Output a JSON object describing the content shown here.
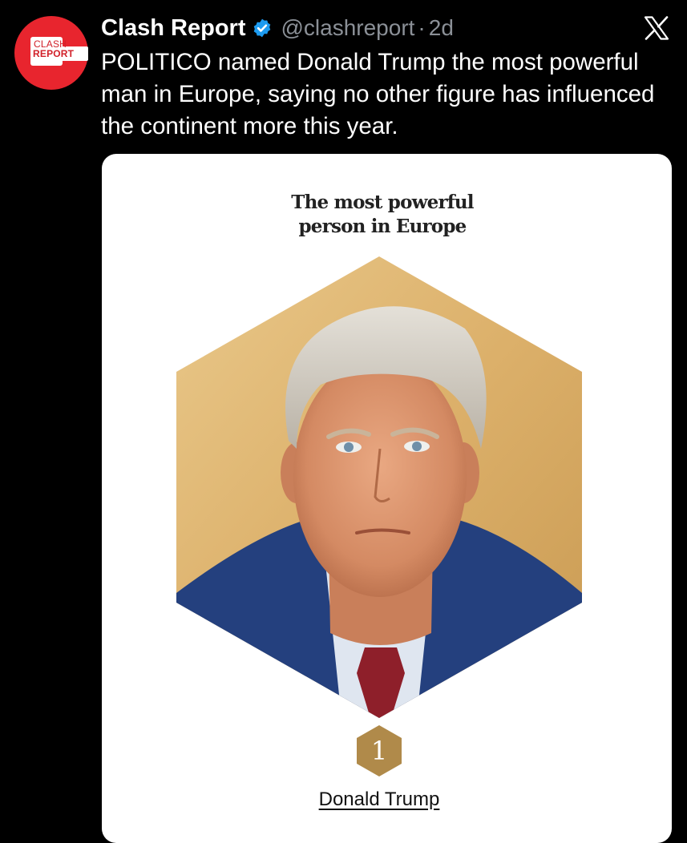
{
  "tweet": {
    "author_name": "Clash Report",
    "author_handle": "@clashreport",
    "separator": "·",
    "time_ago": "2d",
    "avatar_line1": "CLASH",
    "avatar_line2": "REPORT",
    "text": "POLITICO named Donald Trump the most powerful man in Europe, saying no other figure has influenced the continent more this year.",
    "verified": true
  },
  "card": {
    "title_line1": "The most powerful",
    "title_line2": "person in Europe",
    "rank": "1",
    "person_name": "Donald Trump"
  },
  "icons": {
    "verified": "verified-badge-icon",
    "platform": "x-logo-icon"
  },
  "colors": {
    "background": "#000000",
    "avatar": "#e8252e",
    "verified": "#1d9bf0",
    "handle": "#8b9097",
    "rank_badge": "#b08a4a"
  }
}
